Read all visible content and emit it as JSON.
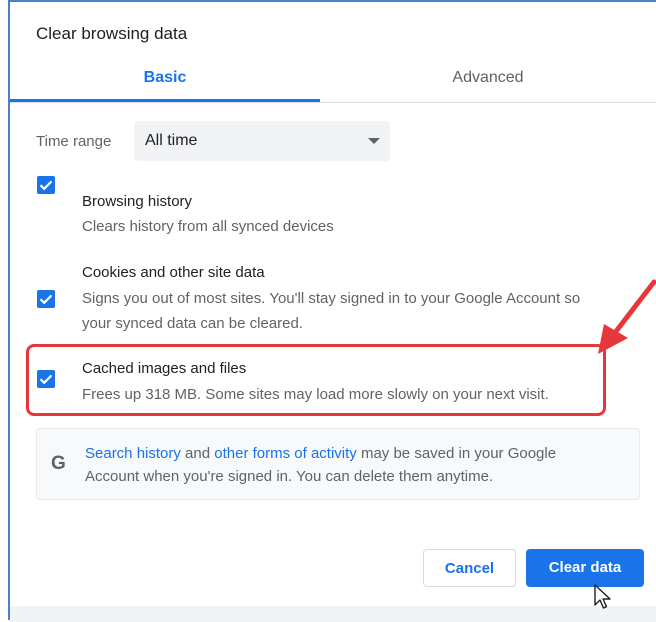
{
  "dialog": {
    "title": "Clear browsing data"
  },
  "tabs": [
    {
      "label": "Basic",
      "active": true
    },
    {
      "label": "Advanced",
      "active": false
    }
  ],
  "time_range": {
    "label": "Time range",
    "value": "All time"
  },
  "items": [
    {
      "title": "Browsing history",
      "description": "Clears history from all synced devices",
      "checked": true
    },
    {
      "title": "Cookies and other site data",
      "description_lines": [
        "Signs you out of most sites. You'll stay signed in to your Google Account so",
        "your synced data can be cleared."
      ],
      "checked": true
    },
    {
      "title": "Cached images and files",
      "description": "Frees up 318 MB. Some sites may load more slowly on your next visit.",
      "checked": true
    }
  ],
  "info": {
    "link1": "Search history",
    "text1": " and ",
    "link2": "other forms of activity",
    "text2": " may be saved in your Google",
    "line2": "Account when you're signed in. You can delete them anytime.",
    "icon_letter": "G"
  },
  "buttons": {
    "cancel": "Cancel",
    "clear": "Clear data"
  },
  "colors": {
    "accent": "#1a73e8",
    "annotation": "#e8373a",
    "frame": "#4a7fc9"
  }
}
